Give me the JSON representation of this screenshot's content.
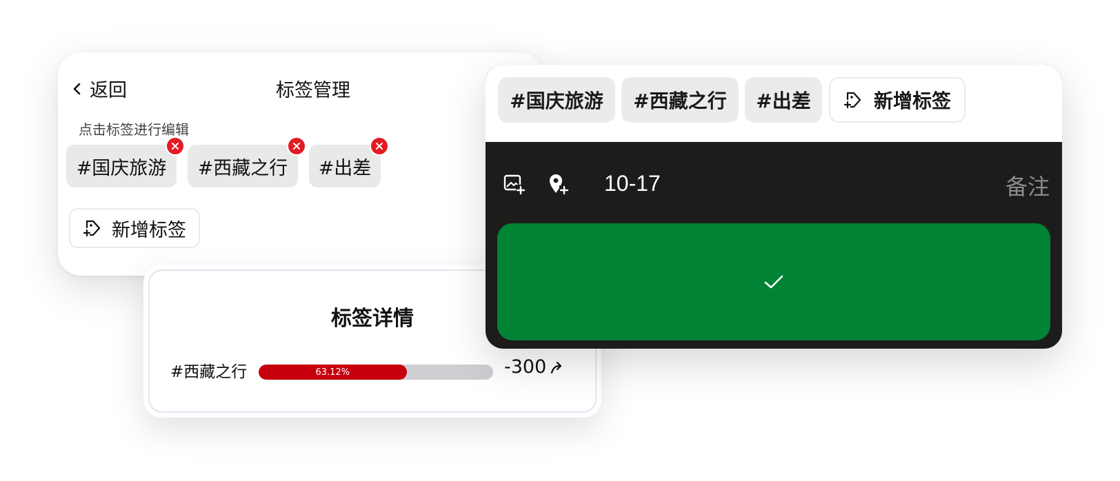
{
  "tag_manager": {
    "back_label": "返回",
    "title": "标签管理",
    "hint": "点击标签进行编辑",
    "tags": [
      "#国庆旅游",
      "#西藏之行",
      "#出差"
    ],
    "add_label": "新增标签"
  },
  "tag_detail": {
    "title": "标签详情",
    "rows": [
      {
        "tag": "#西藏之行",
        "percent_label": "63.12%",
        "percent": 63.12,
        "amount": "-300"
      }
    ]
  },
  "entry_panel": {
    "tags": [
      "#国庆旅游",
      "#西藏之行",
      "#出差"
    ],
    "add_label": "新增标签",
    "date": "10-17",
    "note_label": "备注"
  },
  "colors": {
    "delete_badge": "#e31b23",
    "bar_fill": "#c8000e",
    "confirm_green": "#008335",
    "panel_dark": "#1d1c1b"
  }
}
